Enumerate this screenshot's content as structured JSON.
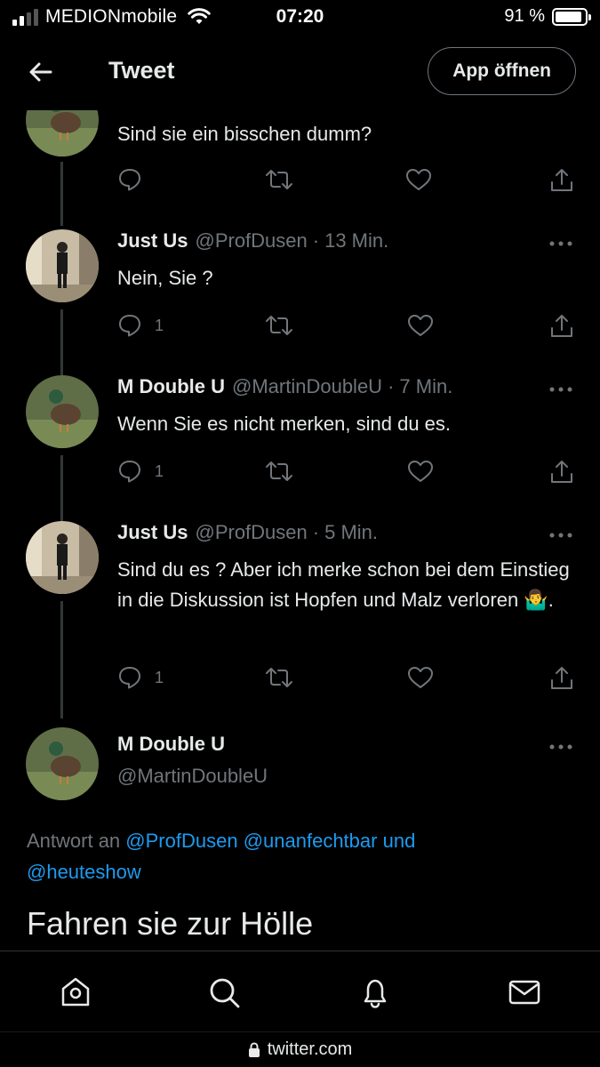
{
  "status": {
    "carrier": "MEDIONmobile",
    "time": "07:20",
    "battery": "91 %",
    "battery_level": 0.91
  },
  "header": {
    "title": "Tweet",
    "open_app": "App öffnen"
  },
  "tweets": [
    {
      "name": "",
      "handle": "",
      "time": "",
      "text": "Sind sie ein bisschen dumm?",
      "replies": "",
      "avatar": "duck"
    },
    {
      "name": "Just Us",
      "handle": "@ProfDusen",
      "dot": "·",
      "time": "13 Min.",
      "text": "Nein, Sie ?",
      "replies": "1",
      "avatar": "person"
    },
    {
      "name": "M Double U",
      "handle": "@MartinDoubleU",
      "dot": "·",
      "time": "7 Min.",
      "text": "Wenn Sie es nicht merken, sind du es.",
      "replies": "1",
      "avatar": "duck"
    },
    {
      "name": "Just Us",
      "handle": "@ProfDusen",
      "dot": "·",
      "time": "5 Min.",
      "text": "Sind du es ? Aber ich merke schon bei dem Einstieg in die Diskussion ist Hopfen und Malz verloren 🤷‍♂️.",
      "replies": "1",
      "avatar": "person"
    }
  ],
  "main_tweet": {
    "name": "M Double U",
    "handle": "@MartinDoubleU",
    "reply_prefix": "Antwort an",
    "mentions": [
      "@ProfDusen",
      "@unanfechtbar"
    ],
    "and": "und",
    "mention_last": "@heuteshow",
    "text": "Fahren sie zur Hölle"
  },
  "url": "twitter.com",
  "icons": {
    "back": "arrow-left-icon",
    "more": "more-horizontal-icon",
    "reply": "reply-icon",
    "retweet": "retweet-icon",
    "like": "heart-icon",
    "share": "share-icon",
    "home": "home-icon",
    "search": "search-icon",
    "notifications": "bell-icon",
    "messages": "mail-icon",
    "lock": "lock-icon"
  },
  "colors": {
    "background": "#000000",
    "text": "#e7e9ea",
    "muted": "#71767b",
    "link": "#1d9bf0"
  }
}
